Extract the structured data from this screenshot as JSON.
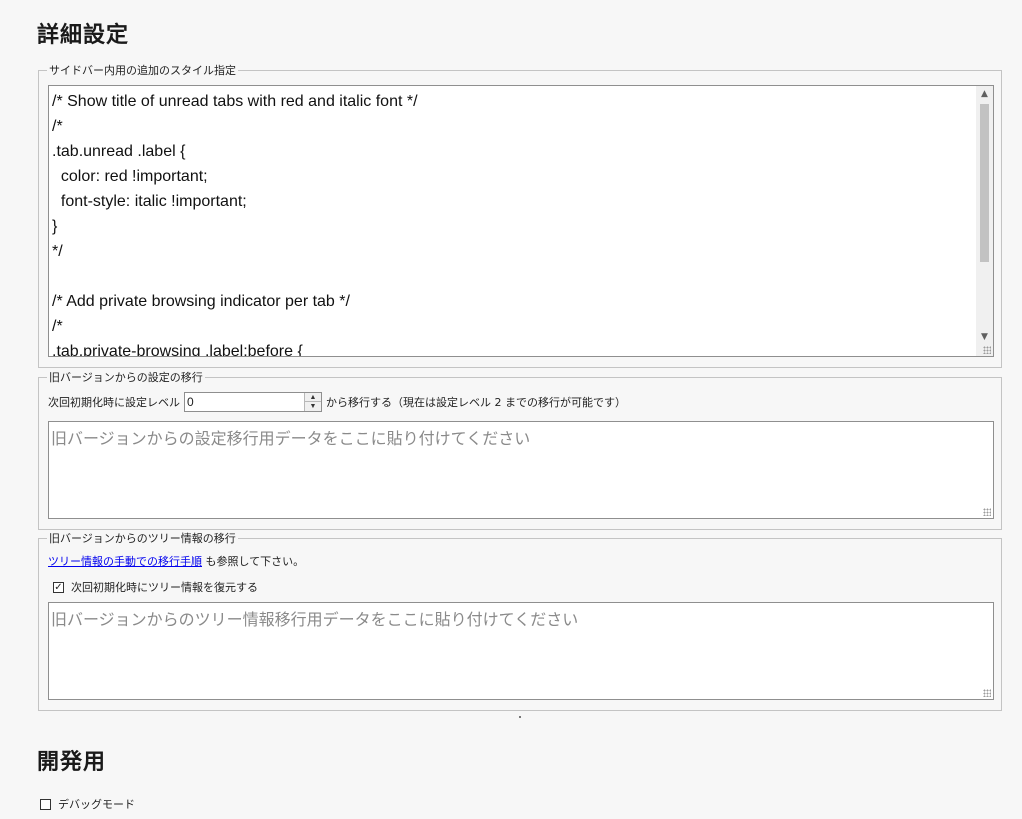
{
  "sections": {
    "advanced_title": "詳細設定",
    "dev_title": "開発用"
  },
  "style_group": {
    "legend": "サイドバー内用の追加のスタイル指定",
    "code_lines": [
      "/* Show title of unread tabs with red and italic font */",
      "/*",
      ".tab.unread .label {",
      "  color: red !important;",
      "  font-style: italic !important;",
      "}",
      "*/",
      "",
      "/* Add private browsing indicator per tab */",
      "/*",
      ".tab.private-browsing .label:before {"
    ]
  },
  "migrate_group": {
    "legend": "旧バージョンからの設定の移行",
    "prefix_label": "次回初期化時に設定レベル",
    "level_value": "0",
    "suffix_label": "から移行する（現在は設定レベル 2 までの移行が可能です）",
    "placeholder": "旧バージョンからの設定移行用データをここに貼り付けてください"
  },
  "tree_group": {
    "legend": "旧バージョンからのツリー情報の移行",
    "link_text": "ツリー情報の手動での移行手順",
    "note_suffix": "も参照して下さい。",
    "restore_label": "次回初期化時にツリー情報を復元する",
    "restore_checked": true,
    "placeholder": "旧バージョンからのツリー情報移行用データをここに貼り付けてください"
  },
  "dev_group": {
    "debug_label": "デバッグモード",
    "debug_checked": false
  },
  "icons": {
    "scroll_up": "▲",
    "scroll_down": "▼",
    "spin_up": "▲",
    "spin_down": "▼",
    "check": "✓"
  }
}
